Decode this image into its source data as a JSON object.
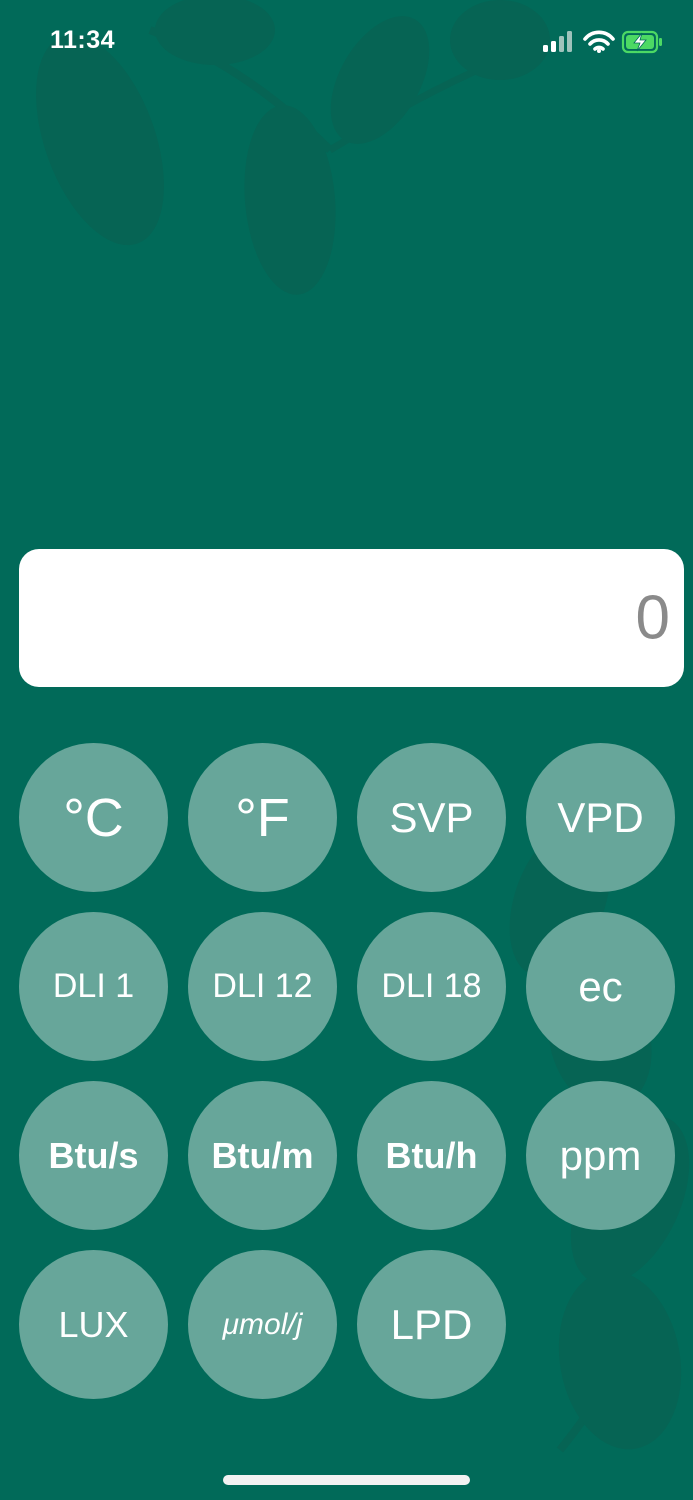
{
  "status_bar": {
    "time": "11:34",
    "icons": [
      "cellular-signal-icon",
      "wifi-icon",
      "battery-charging-icon"
    ]
  },
  "display": {
    "value": "0"
  },
  "keypad": {
    "rows": [
      [
        "°C",
        "°F",
        "SVP",
        "VPD"
      ],
      [
        "DLI 1",
        "DLI 12",
        "DLI 18",
        "ec"
      ],
      [
        "Btu/s",
        "Btu/m",
        "Btu/h",
        "ppm"
      ],
      [
        "LUX",
        "μmol/j",
        "LPD"
      ]
    ]
  },
  "colors": {
    "background": "#016a59",
    "key": "#67a69a",
    "display_bg": "#ffffff",
    "display_text": "#8a8a8a",
    "battery": "#4cd964"
  }
}
